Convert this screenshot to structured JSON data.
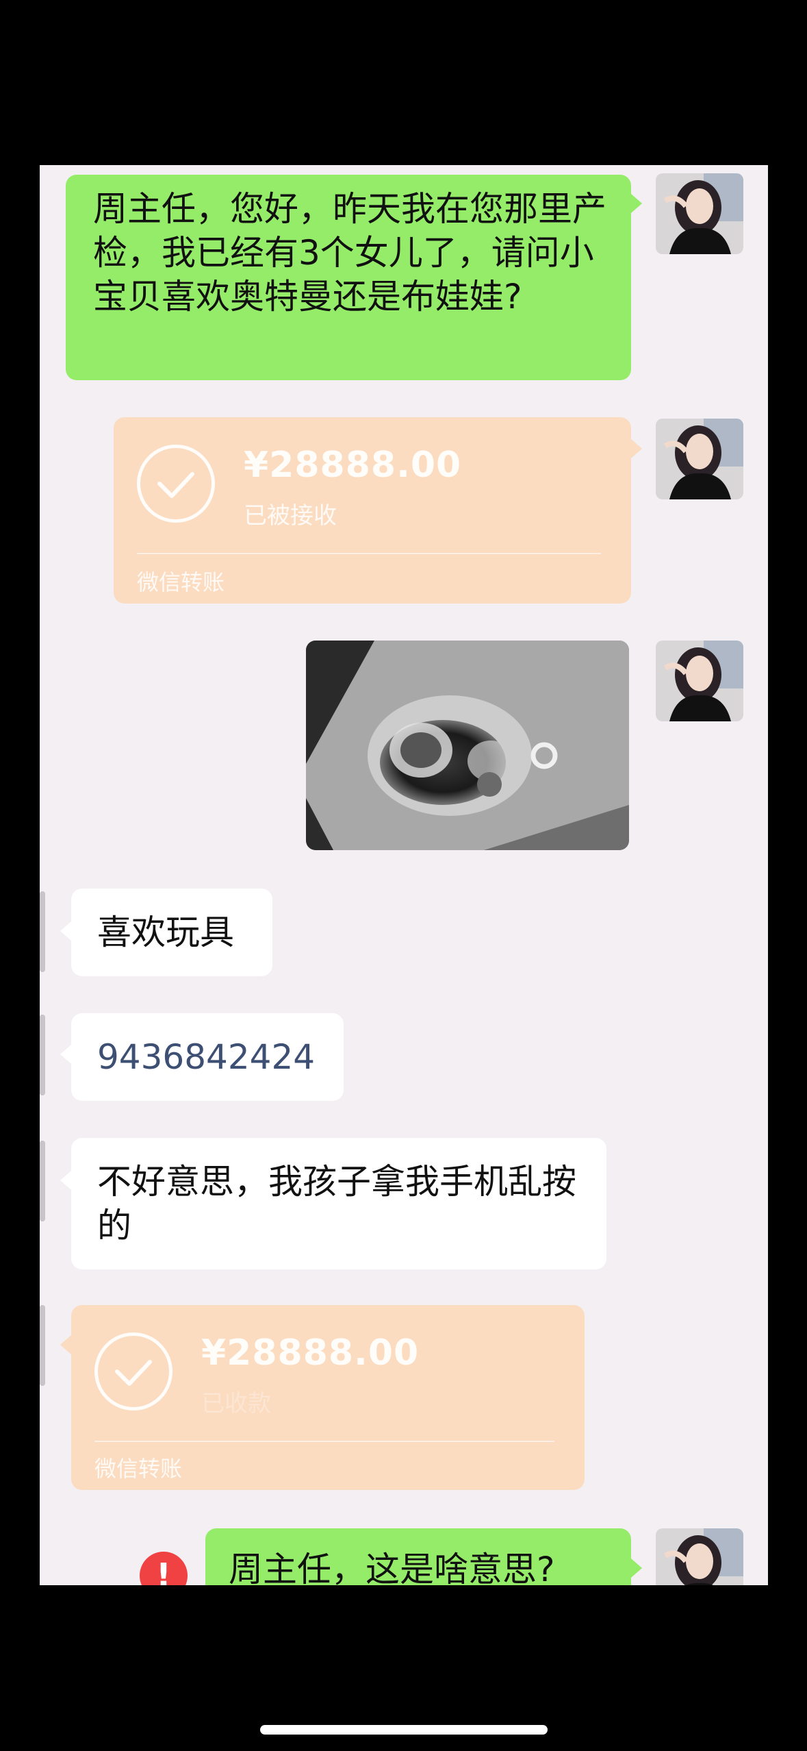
{
  "messages": {
    "m1": {
      "text": "周主任，您好，昨天我在您那里产检，我已经有3个女儿了，请问小宝贝喜欢奥特曼还是布娃娃?"
    },
    "m2": {
      "amount": "¥28888.00",
      "status": "已被接收",
      "label": "微信转账"
    },
    "m4": {
      "text": "喜欢玩具"
    },
    "m5": {
      "text": "9436842424"
    },
    "m6": {
      "text": "不好意思，我孩子拿我手机乱按的"
    },
    "m7": {
      "amount": "¥28888.00",
      "status": "已收款",
      "label": "微信转账"
    },
    "m8": {
      "text": "周主任，这是啥意思?",
      "error_icon": "!"
    }
  },
  "colors": {
    "sent_bubble": "#95ec69",
    "received_bubble": "#ffffff",
    "transfer_card": "#fbdcc0",
    "chat_background": "#f3eff2",
    "error": "#f04242",
    "link_number": "#3d4f72"
  },
  "icons": {
    "avatar": "user-avatar",
    "check": "check-circle-icon",
    "error": "error-icon",
    "photo": "ultrasound-image"
  }
}
